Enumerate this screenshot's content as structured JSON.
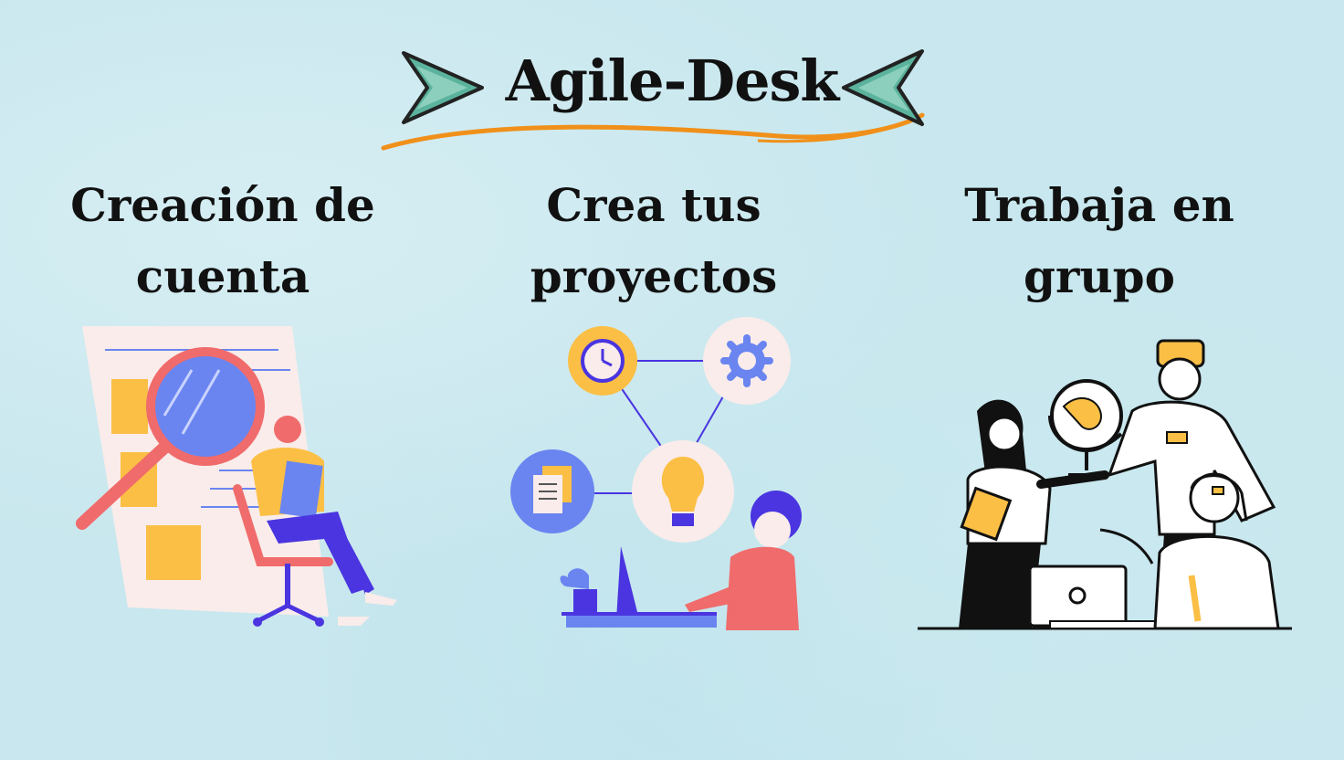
{
  "header": {
    "title": "Agile-Desk"
  },
  "features": [
    {
      "title": "Creación de cuenta"
    },
    {
      "title": "Crea tus proyectos"
    },
    {
      "title": "Trabaja en grupo"
    }
  ],
  "colors": {
    "background": "#c8e7ee",
    "arrow_teal": "#5bb39d",
    "swoosh_orange": "#f0901a",
    "accent_yellow": "#fbbf45",
    "accent_blue": "#6a85f0",
    "accent_coral": "#f06b6b"
  },
  "illustrations": [
    {
      "icon": "magnifier-document-illustration"
    },
    {
      "icon": "idea-network-illustration"
    },
    {
      "icon": "team-globe-illustration"
    }
  ]
}
